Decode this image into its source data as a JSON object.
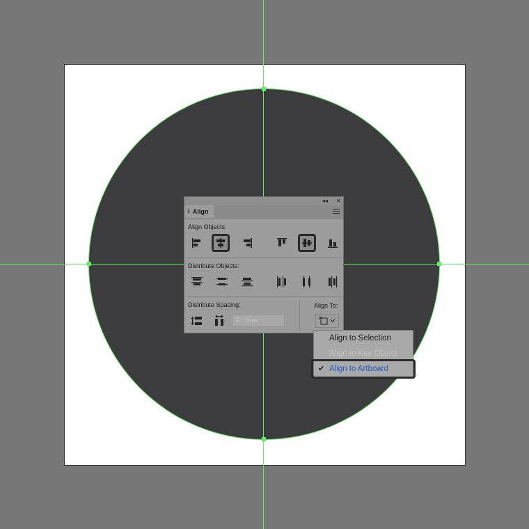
{
  "panel": {
    "title": "Align",
    "tab_toggle_glyph": "⇕",
    "collapse_glyph": "◂◂",
    "close_glyph": "✕",
    "align_objects_label": "Align Objects:",
    "distribute_objects_label": "Distribute Objects:",
    "distribute_spacing_label": "Distribute Spacing:",
    "align_to_label": "Align To:",
    "spacing_value": "0 px",
    "selected_buttons": [
      "horizontal-align-center-button",
      "vertical-align-center-button"
    ]
  },
  "dropdown": {
    "items": [
      {
        "label": "Align to Selection",
        "state": "enabled"
      },
      {
        "label": "Align to Key Object",
        "state": "disabled"
      },
      {
        "label": "Align to Artboard",
        "state": "checked"
      }
    ],
    "check_glyph": "✔"
  },
  "colors": {
    "canvas_bg": "#777777",
    "artboard": "#ffffff",
    "circle_fill": "#3c3c3e",
    "guide": "#5cf05c",
    "checked_item_text": "#1e5fc9"
  }
}
